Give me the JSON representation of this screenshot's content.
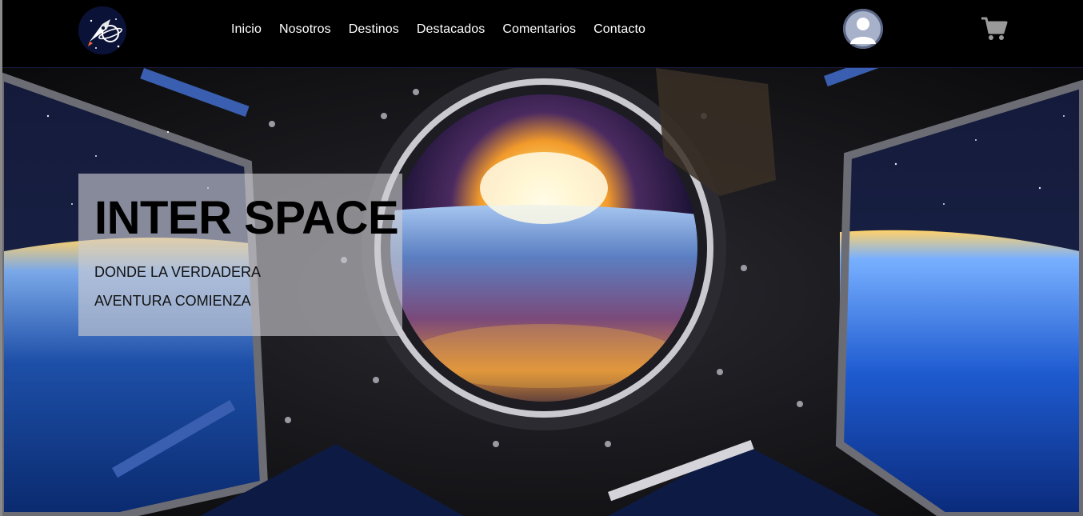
{
  "nav": {
    "logo_icon": "rocket-planet-logo-icon",
    "items": [
      {
        "label": "Inicio"
      },
      {
        "label": "Nosotros"
      },
      {
        "label": "Destinos"
      },
      {
        "label": "Destacados"
      },
      {
        "label": "Comentarios"
      },
      {
        "label": "Contacto"
      }
    ],
    "avatar_icon": "user-avatar-icon",
    "cart_icon": "shopping-cart-icon"
  },
  "hero": {
    "title": "INTER SPACE",
    "subtitle": "DONDE LA VERDADERA AVENTURA COMIENZA",
    "background_image": "space-station-window-earth-sunrise"
  },
  "colors": {
    "nav_background": "#000000",
    "nav_text": "#ffffff",
    "cart_icon": "#9a9a9a",
    "card_background": "#cdcdd2"
  }
}
